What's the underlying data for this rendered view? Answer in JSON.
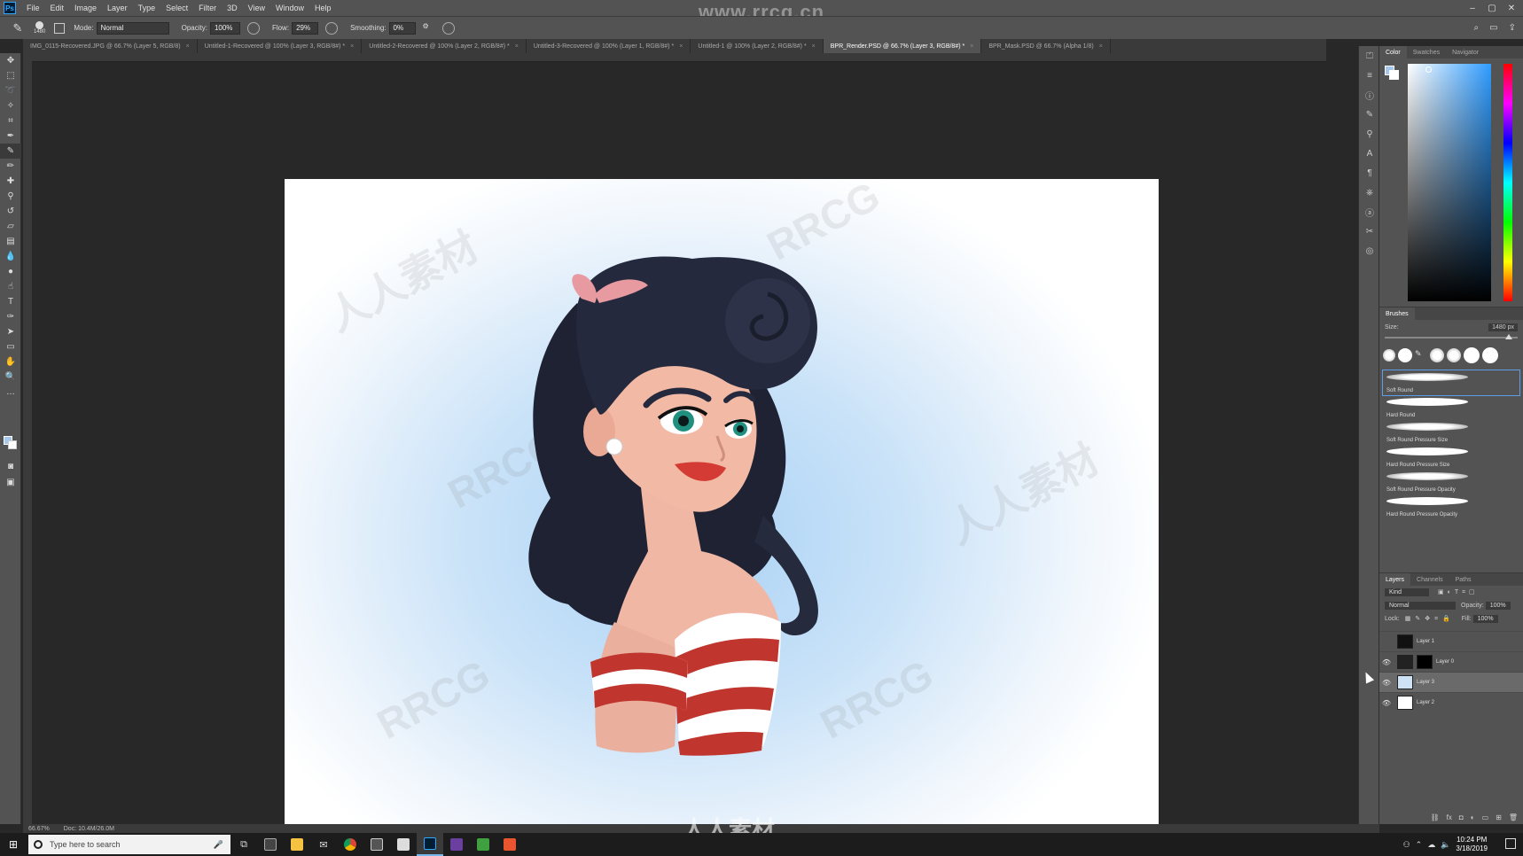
{
  "site_watermark": "www.rrcg.cn",
  "bottom_watermark": "人人素材",
  "canvas_watermarks": [
    "RRCG",
    "人人素材"
  ],
  "menu": [
    "File",
    "Edit",
    "Image",
    "Layer",
    "Type",
    "Select",
    "Filter",
    "3D",
    "View",
    "Window",
    "Help"
  ],
  "options": {
    "brush_size": "1480",
    "mode_label": "Mode:",
    "mode_value": "Normal",
    "opacity_label": "Opacity:",
    "opacity_value": "100%",
    "flow_label": "Flow:",
    "flow_value": "29%",
    "smoothing_label": "Smoothing:",
    "smoothing_value": "0%"
  },
  "tabs": [
    "IMG_0115-Recovered.JPG @ 66.7% (Layer 5, RGB/8)",
    "Untitled-1-Recovered @ 100% (Layer 3, RGB/8#) *",
    "Untitled-2-Recovered @ 100% (Layer 2, RGB/8#) *",
    "Untitled-3-Recovered @ 100% (Layer 1, RGB/8#) *",
    "Untitled-1 @ 100% (Layer 2, RGB/8#) *",
    "BPR_Render.PSD @ 66.7% (Layer 3, RGB/8#) *",
    "BPR_Mask.PSD @ 66.7% (Alpha 1/8)"
  ],
  "active_tab_index": 5,
  "status": {
    "zoom": "66.67%",
    "doc": "Doc: 10.4M/26.0M"
  },
  "color_panel": {
    "tabs": [
      "Color",
      "Swatches",
      "Navigator"
    ],
    "fg": "#a6c8ec",
    "bg": "#ffffff"
  },
  "brushes_panel": {
    "title": "Brushes",
    "size_label": "Size:",
    "size_value": "1480 px",
    "items": [
      "Soft Round",
      "Hard Round",
      "Soft Round Pressure Size",
      "Hard Round Pressure Size",
      "Soft Round Pressure Opacity",
      "Hard Round Pressure Opacity"
    ]
  },
  "layers_panel": {
    "tabs": [
      "Layers",
      "Channels",
      "Paths"
    ],
    "kind_label": "Kind",
    "blend": "Normal",
    "opacity_label": "Opacity:",
    "opacity_value": "100%",
    "lock_label": "Lock:",
    "fill_label": "Fill:",
    "fill_value": "100%",
    "layers": [
      {
        "name": "Layer 1",
        "visible": false,
        "selected": false,
        "thumb": "#111"
      },
      {
        "name": "Layer 0",
        "visible": true,
        "selected": false,
        "thumb": "#222"
      },
      {
        "name": "Layer 3",
        "visible": true,
        "selected": true,
        "thumb": "#cfe3f7"
      },
      {
        "name": "Layer 2",
        "visible": true,
        "selected": false,
        "thumb": "#ffffff"
      }
    ]
  },
  "taskbar": {
    "search_placeholder": "Type here to search",
    "time": "10:24 PM",
    "date": "3/18/2019"
  }
}
